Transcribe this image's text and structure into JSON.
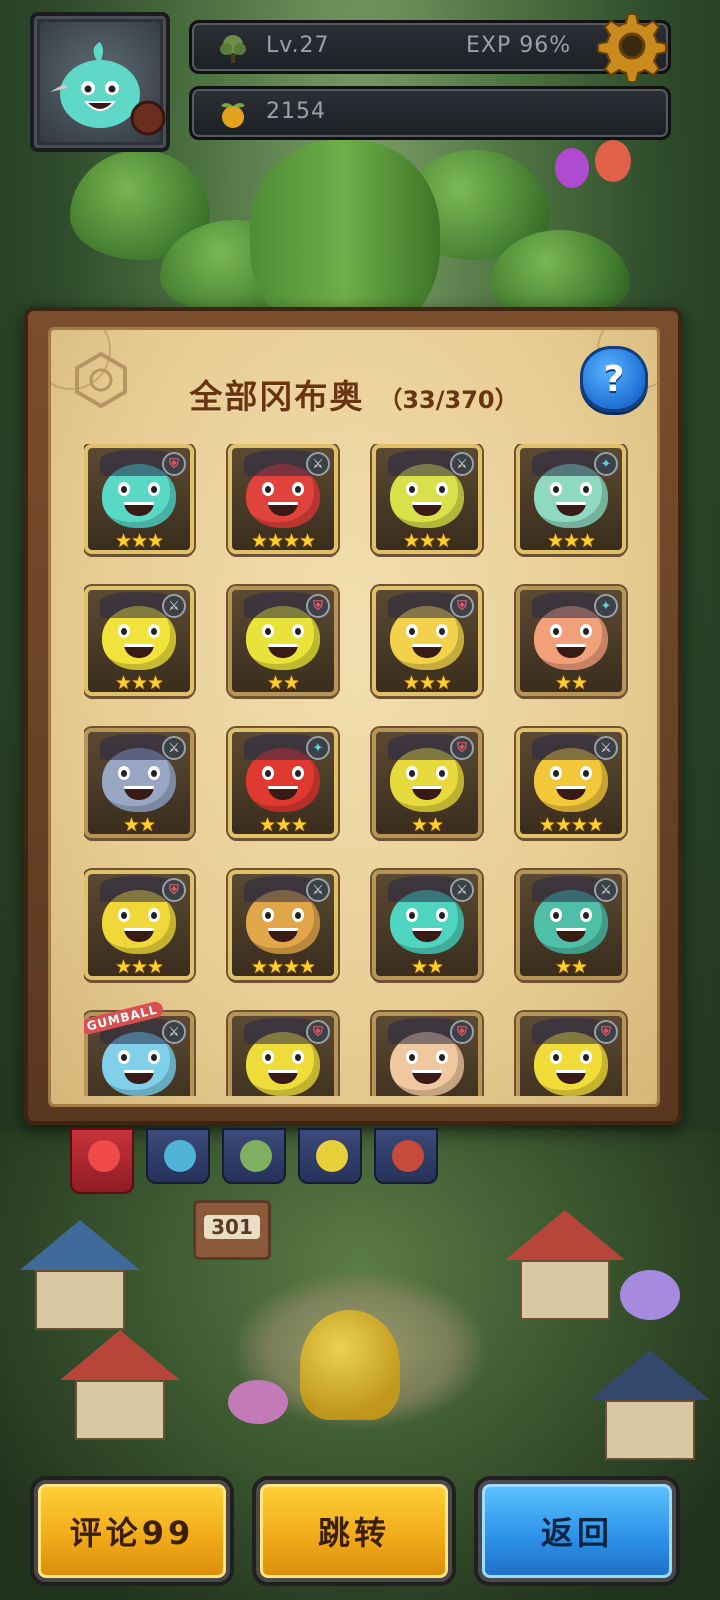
{
  "hud": {
    "level": "Lv.27",
    "exp": "EXP 96%",
    "gold": "2154"
  },
  "panel": {
    "title": "全部冈布奥",
    "count": "（33/370）",
    "help": "?"
  },
  "grid": [
    {
      "name": "gumball-teal-hero",
      "color": "#59d8c6",
      "stars": "★★★",
      "badge": "def",
      "badge_icon": "shield-icon"
    },
    {
      "name": "gumball-red-knight",
      "color": "#e0423c",
      "stars": "★★★★",
      "badge": "atk",
      "badge_icon": "sword-icon"
    },
    {
      "name": "gumball-green-wizard",
      "color": "#d9e04a",
      "stars": "★★★",
      "badge": "atk",
      "badge_icon": "sword-icon"
    },
    {
      "name": "gumball-witch",
      "color": "#8fd9c0",
      "stars": "★★★",
      "badge": "mag",
      "badge_icon": "magic-icon"
    },
    {
      "name": "gumball-tribal",
      "color": "#f2e23c",
      "stars": "★★★",
      "badge": "atk",
      "badge_icon": "sword-icon"
    },
    {
      "name": "gumball-feathered",
      "color": "#e8e23a",
      "stars": "★★",
      "badge": "def",
      "badge_icon": "shield-icon"
    },
    {
      "name": "gumball-cowboy",
      "color": "#f2d24a",
      "stars": "★★★",
      "badge": "def",
      "badge_icon": "shield-icon"
    },
    {
      "name": "gumball-coral",
      "color": "#f2a07a",
      "stars": "★★",
      "badge": "mag",
      "badge_icon": "magic-icon"
    },
    {
      "name": "gumball-ice-demon",
      "color": "#9aa7c4",
      "stars": "★★",
      "badge": "atk",
      "badge_icon": "sword-icon"
    },
    {
      "name": "gumball-fire",
      "color": "#e03a30",
      "stars": "★★★",
      "badge": "mag",
      "badge_icon": "magic-icon"
    },
    {
      "name": "gumball-purple-mage",
      "color": "#e8da3c",
      "stars": "★★",
      "badge": "def",
      "badge_icon": "shield-icon"
    },
    {
      "name": "gumball-monkey-king",
      "color": "#f2c83a",
      "stars": "★★★★",
      "badge": "atk",
      "badge_icon": "sword-icon"
    },
    {
      "name": "gumball-top-hat",
      "color": "#f0d83a",
      "stars": "★★★",
      "badge": "def",
      "badge_icon": "shield-icon"
    },
    {
      "name": "gumball-cyborg",
      "color": "#e2a64a",
      "stars": "★★★★",
      "badge": "atk",
      "badge_icon": "sword-icon"
    },
    {
      "name": "gumball-warrior",
      "color": "#4fd4bf",
      "stars": "★★",
      "badge": "atk",
      "badge_icon": "sword-icon"
    },
    {
      "name": "gumball-dark-wing",
      "color": "#4fbfa8",
      "stars": "★★",
      "badge": "atk",
      "badge_icon": "sword-icon"
    },
    {
      "name": "gumball-gumball-logo",
      "color": "#7fd0e8",
      "stars": "",
      "badge": "atk",
      "badge_icon": "sword-icon",
      "ribbon": "GUMBALL"
    },
    {
      "name": "gumball-knight-helm",
      "color": "#eedc3a",
      "stars": "",
      "badge": "def",
      "badge_icon": "shield-icon"
    },
    {
      "name": "gumball-bunny",
      "color": "#f0c8a0",
      "stars": "",
      "badge": "def",
      "badge_icon": "shield-icon"
    },
    {
      "name": "gumball-officer",
      "color": "#f2dc3a",
      "stars": "",
      "badge": "def",
      "badge_icon": "shield-icon"
    }
  ],
  "tabs": [
    {
      "name": "tab-all",
      "color": "#f04a4a"
    },
    {
      "name": "tab-blue",
      "color": "#4fb4d8"
    },
    {
      "name": "tab-green",
      "color": "#7fb060"
    },
    {
      "name": "tab-yellow",
      "color": "#e8d03a"
    },
    {
      "name": "tab-red",
      "color": "#c84a3a"
    }
  ],
  "scene": {
    "sign_number": "301"
  },
  "buttons": {
    "comment": "评论99",
    "jump": "跳转",
    "back": "返回"
  },
  "colors": {
    "panel_title": "#6b3410",
    "star": "#ffcf2e",
    "yellow_button": "#f0a818",
    "blue_button": "#2b8fe6"
  }
}
